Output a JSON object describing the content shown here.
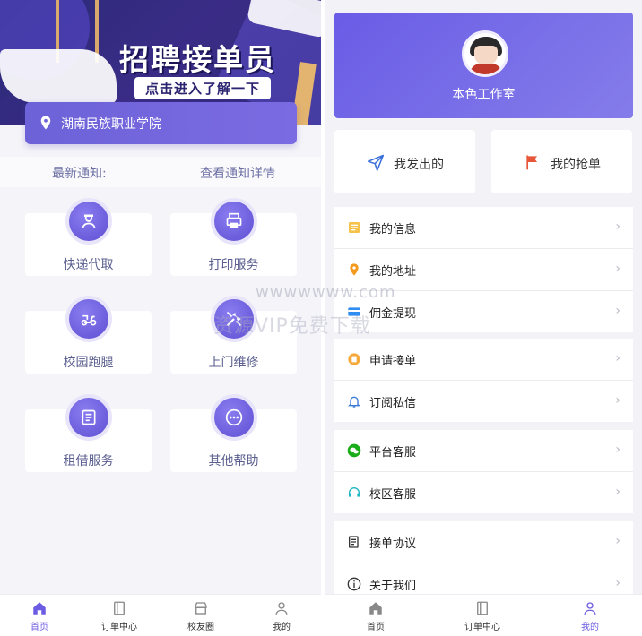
{
  "left": {
    "banner": {
      "title": "招聘接单员",
      "subtitle": "点击进入了解一下"
    },
    "location": "湖南民族职业学院",
    "notice": {
      "label": "最新通知:",
      "link": "查看通知详情"
    },
    "services": [
      {
        "label": "快递代取",
        "icon": "courier-icon"
      },
      {
        "label": "打印服务",
        "icon": "printer-icon"
      },
      {
        "label": "校园跑腿",
        "icon": "scooter-icon"
      },
      {
        "label": "上门维修",
        "icon": "tools-icon"
      },
      {
        "label": "租借服务",
        "icon": "rent-icon"
      },
      {
        "label": "其他帮助",
        "icon": "more-icon"
      }
    ],
    "tabs": [
      {
        "label": "首页",
        "icon": "home-icon"
      },
      {
        "label": "订单中心",
        "icon": "order-icon"
      },
      {
        "label": "校友圈",
        "icon": "shop-icon"
      },
      {
        "label": "我的",
        "icon": "user-icon"
      }
    ],
    "active_tab": "首页"
  },
  "right": {
    "profile": {
      "name": "本色工作室"
    },
    "quick": [
      {
        "label": "我发出的",
        "icon": "send-icon",
        "color": "#3b6fd8"
      },
      {
        "label": "我的抢单",
        "icon": "flag-icon",
        "color": "#e8563a"
      }
    ],
    "menu_groups": [
      [
        {
          "label": "我的信息",
          "icon": "info-card-icon"
        },
        {
          "label": "我的地址",
          "icon": "location-icon"
        },
        {
          "label": "佣金提现",
          "icon": "wallet-icon"
        }
      ],
      [
        {
          "label": "申请接单",
          "icon": "apply-icon"
        },
        {
          "label": "订阅私信",
          "icon": "bell-icon"
        }
      ],
      [
        {
          "label": "平台客服",
          "icon": "wechat-icon"
        },
        {
          "label": "校区客服",
          "icon": "support-icon"
        }
      ],
      [
        {
          "label": "接单协议",
          "icon": "document-icon"
        },
        {
          "label": "关于我们",
          "icon": "about-icon"
        }
      ]
    ],
    "tabs": [
      {
        "label": "首页",
        "icon": "home-icon"
      },
      {
        "label": "订单中心",
        "icon": "order-icon"
      },
      {
        "label": "我的",
        "icon": "user-icon"
      }
    ],
    "active_tab": "我的"
  },
  "watermark": {
    "line1": "wwwwwww.com",
    "line2": "资源VIP免费下载"
  },
  "colors": {
    "accent": "#6b5ce3",
    "location_bar": "#7266dd",
    "text_muted": "#6c6fa4"
  }
}
